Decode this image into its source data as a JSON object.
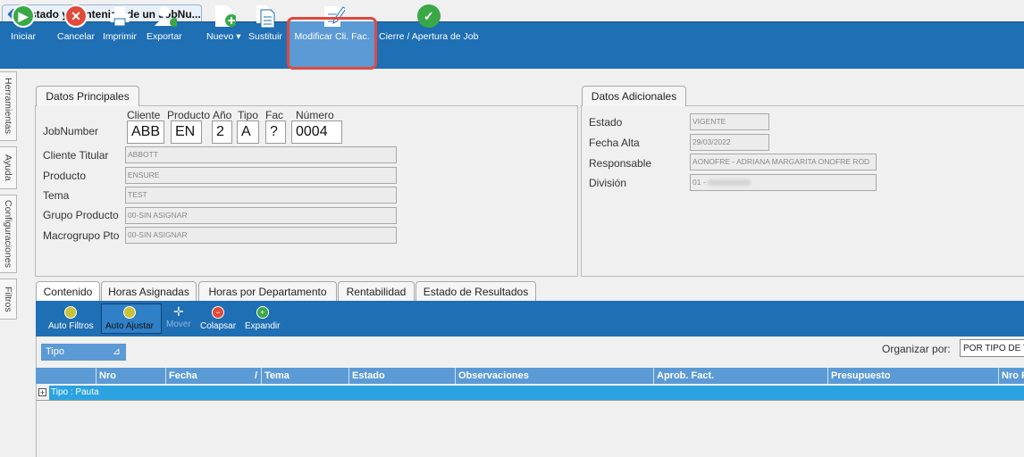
{
  "window": {
    "tab_title": "Estado y Contenido de un JobNu..."
  },
  "toolbar": {
    "items": [
      {
        "label": "Iniciar",
        "icon": "play-circle-icon"
      },
      {
        "label": "Cancelar",
        "icon": "cancel-circle-icon"
      },
      {
        "label": "Imprimir",
        "icon": "printer-icon"
      },
      {
        "label": "Exportar",
        "icon": "export-user-icon"
      },
      {
        "label": "Nuevo",
        "icon": "new-document-icon"
      },
      {
        "label": "Sustituir",
        "icon": "replace-document-icon"
      },
      {
        "label": "Modificar Cli. Fac.",
        "icon": "edit-document-icon"
      },
      {
        "label": "Cierre / Apertura de Job",
        "icon": "checkmark-circle-icon"
      }
    ]
  },
  "side_tabs": [
    "Herramientas",
    "Ayuda",
    "Configuraciones",
    "Filtros"
  ],
  "datos_principales": {
    "title": "Datos Principales",
    "headers": [
      "Cliente",
      "Producto",
      "Año",
      "Tipo",
      "Fac",
      "Número"
    ],
    "jobnumber_label": "JobNumber",
    "jobnumber": {
      "cliente": "ABB",
      "producto": "EN",
      "anio": "2",
      "tipo": "A",
      "fac": "?",
      "numero": "0004"
    },
    "fields": [
      {
        "label": "Cliente Titular",
        "value": "ABBOTT"
      },
      {
        "label": "Producto",
        "value": "ENSURE"
      },
      {
        "label": "Tema",
        "value": "TEST"
      },
      {
        "label": "Grupo Producto",
        "value": "00-SIN ASIGNAR"
      },
      {
        "label": "Macrogrupo Pto",
        "value": "00-SIN ASIGNAR"
      }
    ]
  },
  "datos_adicionales": {
    "title": "Datos Adicionales",
    "fields": [
      {
        "label": "Estado",
        "value": "VIGENTE"
      },
      {
        "label": "Fecha Alta",
        "value": "29/03/2022"
      },
      {
        "label": "Responsable",
        "value": "AONOFRE - ADRIANA MARGARITA ONOFRE ROD"
      },
      {
        "label": "División",
        "value": "01 - "
      }
    ]
  },
  "tabs": [
    "Contenido",
    "Horas Asignadas",
    "Horas por Departamento",
    "Rentabilidad",
    "Estado de Resultados"
  ],
  "subtoolbar": [
    "Auto Filtros",
    "Auto Ajustar",
    "Mover",
    "Colapsar",
    "Expandir"
  ],
  "group_chip": "Tipo",
  "organizar": {
    "label": "Organizar por:",
    "value": "POR TIPO DE TI"
  },
  "grid": {
    "columns": [
      "Nro",
      "Fecha",
      "Tema",
      "Estado",
      "Observaciones",
      "Aprob. Fact.",
      "Presupuesto",
      "Nro P"
    ],
    "group_row": "Tipo : Pauta"
  },
  "colors": {
    "toolbar": "#1f6fb5",
    "highlight": "#e0493d",
    "grid_header": "#5b9ad5",
    "group_row": "#2aa3e0"
  }
}
